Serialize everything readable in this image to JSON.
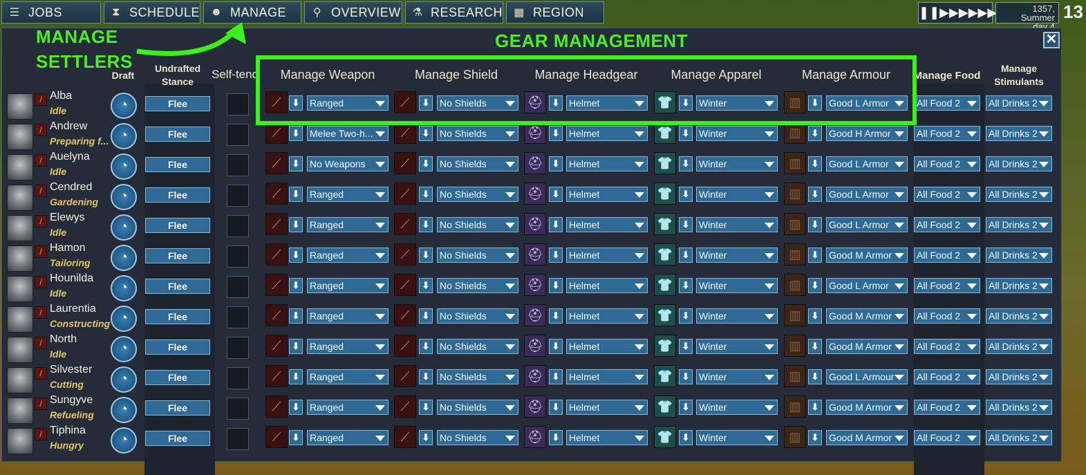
{
  "nav": {
    "tabs": [
      {
        "label": "JOBS",
        "icon": "list-icon"
      },
      {
        "label": "SCHEDULE",
        "icon": "hourglass-icon"
      },
      {
        "label": "MANAGE",
        "icon": "people-icon"
      },
      {
        "label": "OVERVIEW",
        "icon": "magnifier-icon"
      },
      {
        "label": "RESEARCH",
        "icon": "flask-icon"
      },
      {
        "label": "REGION",
        "icon": "map-icon"
      }
    ],
    "date_line1": "1357, Summer",
    "date_line2": "day 4",
    "day_counter": "13"
  },
  "annotations": {
    "manage_settlers_1": "MANAGE",
    "manage_settlers_2": "SETTLERS",
    "gear_management": "GEAR MANAGEMENT",
    "highlight_color": "#3cf01a"
  },
  "headers": {
    "draft": "Draft",
    "stance_1": "Undrafted",
    "stance_2": "Stance",
    "self_tend": "Self-tend",
    "weapon": "Manage Weapon",
    "shield": "Manage Shield",
    "headgear": "Manage Headgear",
    "apparel": "Manage Apparel",
    "armour": "Manage Armour",
    "food": "Manage Food",
    "stimulants_1": "Manage",
    "stimulants_2": "Stimulants"
  },
  "settlers": [
    {
      "name": "Alba",
      "activity": "Idle",
      "stance": "Flee",
      "weapon": "Ranged",
      "shield": "No Shields",
      "headgear": "Helmet",
      "apparel": "Winter",
      "armour": "Good L Armor",
      "food": "All Food 2",
      "drinks": "All Drinks 2"
    },
    {
      "name": "Andrew",
      "activity": "Preparing f...",
      "stance": "Flee",
      "weapon": "Melee Two-h...",
      "shield": "No Shields",
      "headgear": "Helmet",
      "apparel": "Winter",
      "armour": "Good H Armor",
      "food": "All Food 2",
      "drinks": "All Drinks 2"
    },
    {
      "name": "Auelyna",
      "activity": "Idle",
      "stance": "Flee",
      "weapon": "No Weapons",
      "shield": "No Shields",
      "headgear": "Helmet",
      "apparel": "Winter",
      "armour": "Good L Armor",
      "food": "All Food 2",
      "drinks": "All Drinks 2"
    },
    {
      "name": "Cendred",
      "activity": "Gardening",
      "stance": "Flee",
      "weapon": "Ranged",
      "shield": "No Shields",
      "headgear": "Helmet",
      "apparel": "Winter",
      "armour": "Good L Armor",
      "food": "All Food 2",
      "drinks": "All Drinks 2"
    },
    {
      "name": "Elewys",
      "activity": "Idle",
      "stance": "Flee",
      "weapon": "Ranged",
      "shield": "No Shields",
      "headgear": "Helmet",
      "apparel": "Winter",
      "armour": "Good L Armor",
      "food": "All Food 2",
      "drinks": "All Drinks 2"
    },
    {
      "name": "Hamon",
      "activity": "Tailoring",
      "stance": "Flee",
      "weapon": "Ranged",
      "shield": "No Shields",
      "headgear": "Helmet",
      "apparel": "Winter",
      "armour": "Good M Armor",
      "food": "All Food 2",
      "drinks": "All Drinks 2"
    },
    {
      "name": "Hounilda",
      "activity": "Idle",
      "stance": "Flee",
      "weapon": "Ranged",
      "shield": "No Shields",
      "headgear": "Helmet",
      "apparel": "Winter",
      "armour": "Good L Armor",
      "food": "All Food 2",
      "drinks": "All Drinks 2"
    },
    {
      "name": "Laurentia",
      "activity": "Constructing",
      "stance": "Flee",
      "weapon": "Ranged",
      "shield": "No Shields",
      "headgear": "Helmet",
      "apparel": "Winter",
      "armour": "Good M Armor",
      "food": "All Food 2",
      "drinks": "All Drinks 2"
    },
    {
      "name": "North",
      "activity": "Idle",
      "stance": "Flee",
      "weapon": "Ranged",
      "shield": "No Shields",
      "headgear": "Helmet",
      "apparel": "Winter",
      "armour": "Good M Armor",
      "food": "All Food 2",
      "drinks": "All Drinks 2"
    },
    {
      "name": "Silvester",
      "activity": "Cutting",
      "stance": "Flee",
      "weapon": "Ranged",
      "shield": "No Shields",
      "headgear": "Helmet",
      "apparel": "Winter",
      "armour": "Good L Armour",
      "food": "All Food 2",
      "drinks": "All Drinks 2"
    },
    {
      "name": "Sungyve",
      "activity": "Refueling",
      "stance": "Flee",
      "weapon": "Ranged",
      "shield": "No Shields",
      "headgear": "Helmet",
      "apparel": "Winter",
      "armour": "Good M Armor",
      "food": "All Food 2",
      "drinks": "All Drinks 2"
    },
    {
      "name": "Tiphina",
      "activity": "Hungry",
      "stance": "Flee",
      "weapon": "Ranged",
      "shield": "No Shields",
      "headgear": "Helmet",
      "apparel": "Winter",
      "armour": "Good M Armor",
      "food": "All Food 2",
      "drinks": "All Drinks 2"
    }
  ]
}
